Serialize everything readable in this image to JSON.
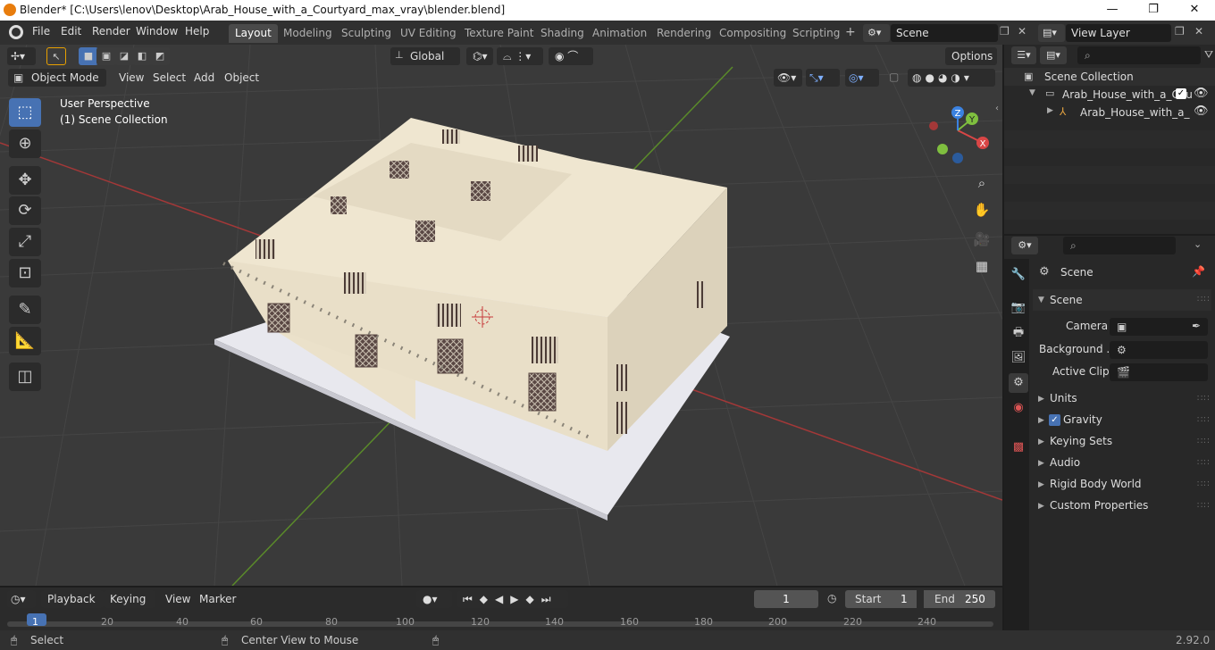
{
  "titlebar": {
    "title": "Blender* [C:\\Users\\lenov\\Desktop\\Arab_House_with_a_Courtyard_max_vray\\blender.blend]",
    "minimize": "—",
    "maximize": "❐",
    "close": "✕"
  },
  "menu": {
    "file": "File",
    "edit": "Edit",
    "render": "Render",
    "window": "Window",
    "help": "Help"
  },
  "workspaces": [
    "Layout",
    "Modeling",
    "Sculpting",
    "UV Editing",
    "Texture Paint",
    "Shading",
    "Animation",
    "Rendering",
    "Compositing",
    "Scripting"
  ],
  "active_workspace": "Layout",
  "scene_field": "Scene",
  "viewlayer_field": "View Layer",
  "viewport": {
    "orientation": "Global",
    "options": "Options",
    "mode": "Object Mode",
    "menus": [
      "View",
      "Select",
      "Add",
      "Object"
    ],
    "overlay_line1": "User Perspective",
    "overlay_line2": "(1) Scene Collection",
    "gizmo_axes": {
      "x": "X",
      "y": "Y",
      "z": "Z"
    }
  },
  "outliner": {
    "root": "Scene Collection",
    "collection": "Arab_House_with_a_Cou",
    "object": "Arab_House_with_a_"
  },
  "properties": {
    "context": "Scene",
    "panel": "Scene",
    "camera_label": "Camera",
    "background_label": "Background ...",
    "active_clip_label": "Active Clip",
    "sections": [
      "Units",
      "Gravity",
      "Keying Sets",
      "Audio",
      "Rigid Body World",
      "Custom Properties"
    ],
    "gravity_checked": true
  },
  "timeline": {
    "playback": "Playback",
    "keying": "Keying",
    "view": "View",
    "marker": "Marker",
    "current_frame": "1",
    "start_label": "Start",
    "start_value": "1",
    "end_label": "End",
    "end_value": "250",
    "ticks": [
      "1",
      "20",
      "40",
      "60",
      "80",
      "100",
      "120",
      "140",
      "160",
      "180",
      "200",
      "220",
      "240"
    ]
  },
  "statusbar": {
    "left": "Select",
    "middle": "Center View to Mouse",
    "version": "2.92.0"
  },
  "colors": {
    "accent": "#4772b3",
    "wall": "#ede4cf",
    "base": "#e8e8ee",
    "x_axis": "#d94646",
    "y_axis": "#7fbf3f",
    "z_axis": "#3b82e0"
  }
}
